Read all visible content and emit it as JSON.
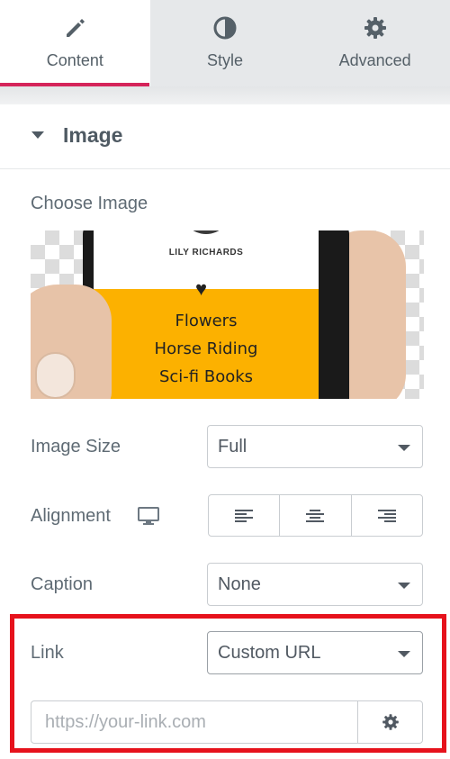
{
  "tabs": [
    {
      "label": "Content",
      "icon": "pencil-icon",
      "active": true
    },
    {
      "label": "Style",
      "icon": "half-circle-icon",
      "active": false
    },
    {
      "label": "Advanced",
      "icon": "gear-icon",
      "active": false
    }
  ],
  "accent_color": "#d5245a",
  "highlight_color": "#e6121c",
  "section": {
    "title": "Image"
  },
  "choose_image": {
    "label": "Choose Image",
    "preview": {
      "name": "LILY RICHARDS",
      "interests": [
        "Flowers",
        "Horse Riding",
        "Sci-fi Books"
      ]
    }
  },
  "image_size": {
    "label": "Image Size",
    "value": "Full"
  },
  "alignment": {
    "label": "Alignment",
    "options": [
      "align-left-icon",
      "align-center-icon",
      "align-right-icon"
    ]
  },
  "caption": {
    "label": "Caption",
    "value": "None"
  },
  "link": {
    "label": "Link",
    "value": "Custom URL",
    "url_value": "",
    "url_placeholder": "https://your-link.com"
  }
}
